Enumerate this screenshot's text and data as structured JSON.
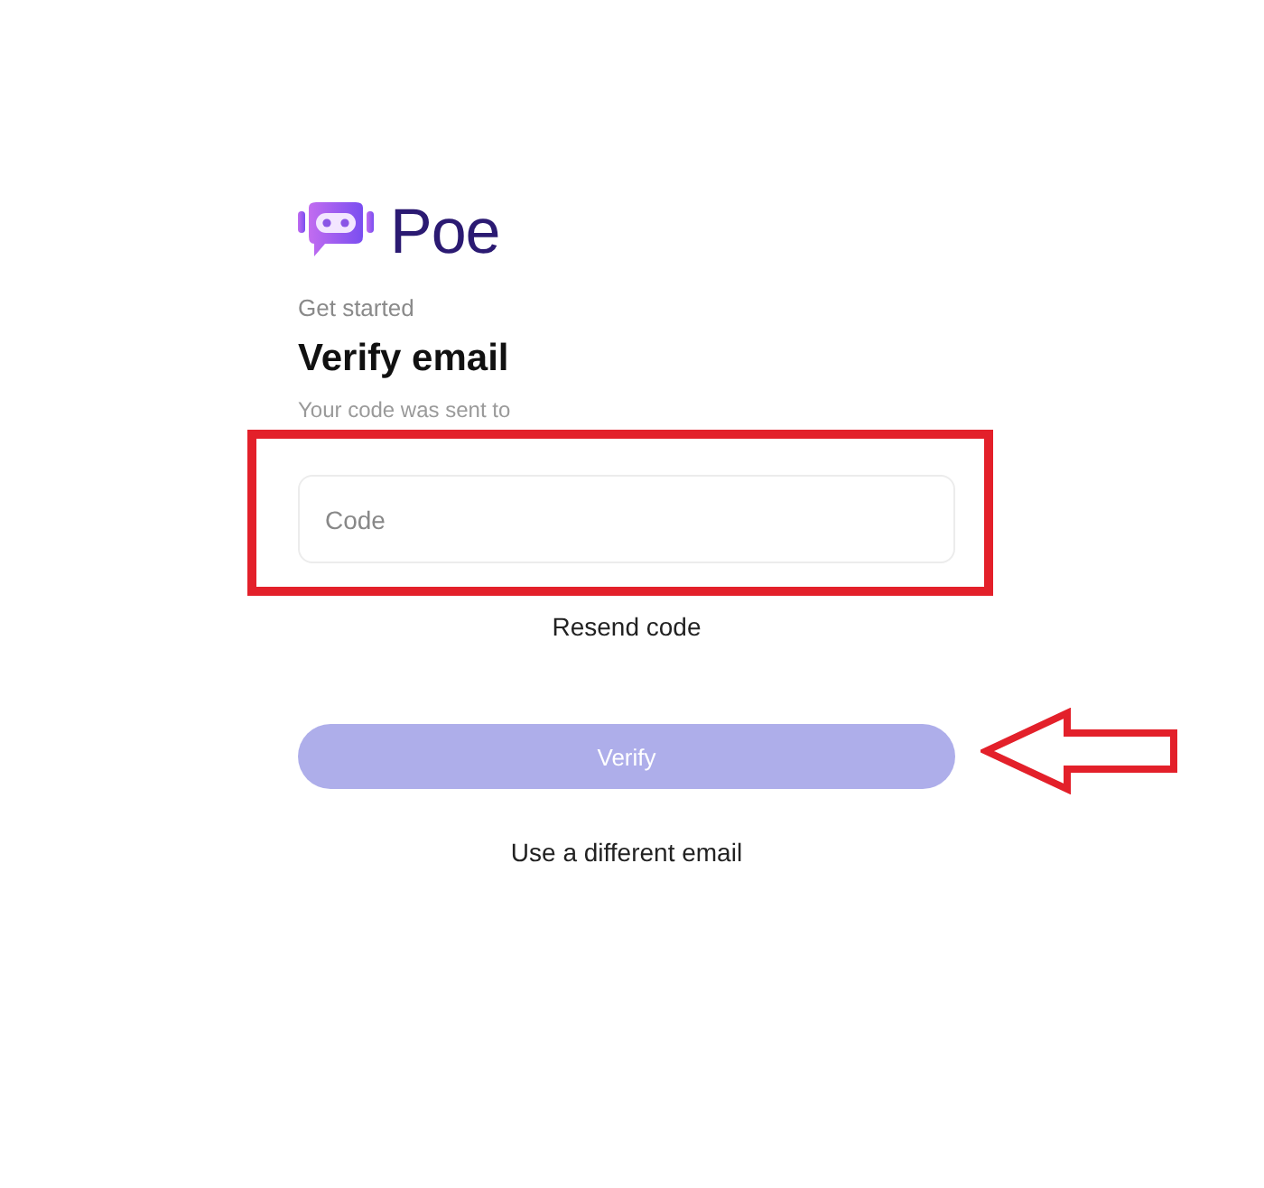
{
  "logo": {
    "text": "Poe"
  },
  "form": {
    "eyebrow": "Get started",
    "title": "Verify email",
    "subtitle": "Your code was sent to",
    "code_field": {
      "placeholder": "Code"
    },
    "resend_link": "Resend code",
    "verify_button": {
      "label": "Verify",
      "disabled": true
    },
    "change_email_link": "Use a different email"
  },
  "annotations": [
    {
      "kind": "rectangle"
    },
    {
      "kind": "arrow"
    }
  ]
}
